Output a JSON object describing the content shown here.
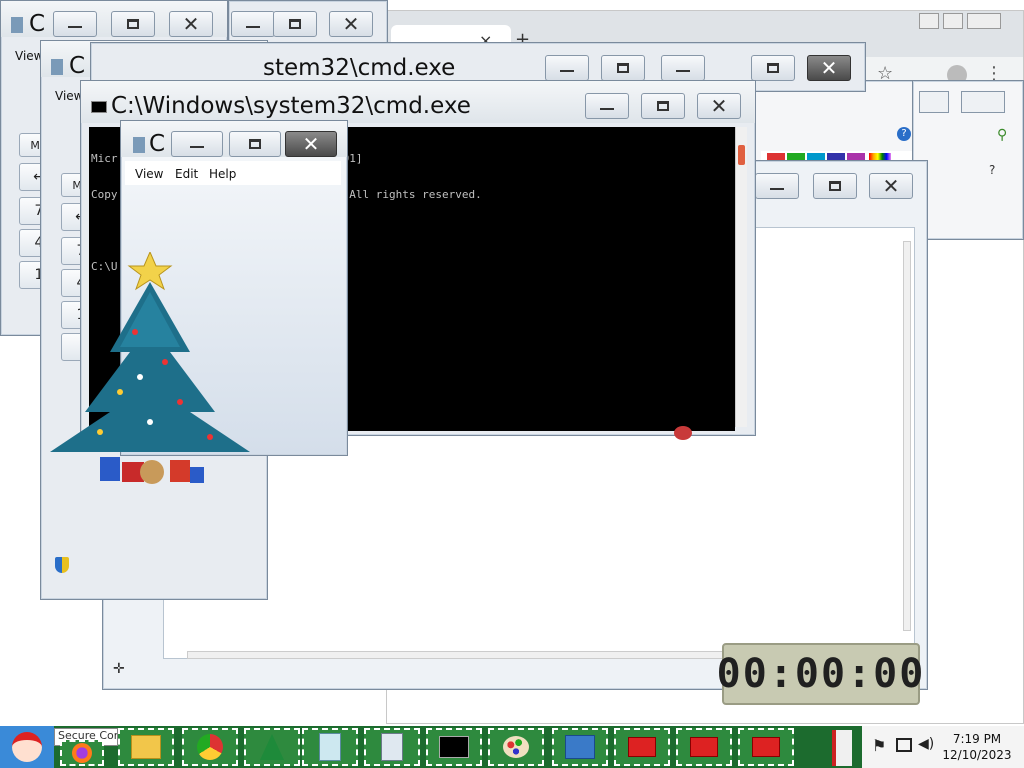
{
  "windows": {
    "cmd_title": "C:\\Windows\\system32\\cmd.exe",
    "cmd_title_partial": "stem32\\cmd.exe",
    "calc_title_letter": "C",
    "browser_tab_close": "×",
    "browser_new_tab": "+"
  },
  "console": {
    "line1": "Micr                                 601]",
    "line2": "Copy                        poration.  All rights reserved.",
    "line3": "C:\\U"
  },
  "calculator": {
    "menu": [
      "View",
      "Edit",
      "Help"
    ],
    "back_menu_view": "View",
    "mc_label": "MC",
    "backspace": "←",
    "digits": [
      "7",
      "4",
      "1"
    ]
  },
  "stopwatch": {
    "display": "00:00:00"
  },
  "taskbar": {
    "start_icon": "santa-icon",
    "tooltip_partial": "Secure Con",
    "apps": [
      "firefox-icon",
      "explorer-icon",
      "chrome-icon",
      "christmas-tree-icon",
      "notepad-icon",
      "calculator-icon",
      "cmd-icon",
      "paint-icon",
      "control-panel-icon",
      "toolbox-icon",
      "toolbox-icon",
      "toolbox-icon"
    ],
    "time": "7:19 PM",
    "date": "12/10/2023"
  },
  "colors": {
    "taskbar_green": "#1c6b2e",
    "console_bg": "#000000",
    "window_frame": "#e8ecf1"
  }
}
